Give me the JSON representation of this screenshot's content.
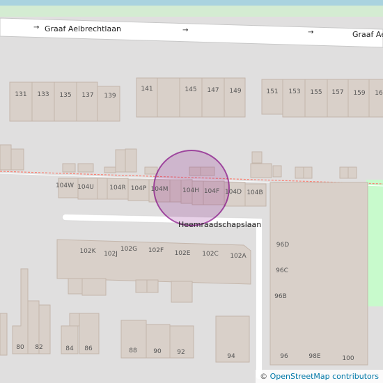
{
  "map": {
    "water_color": "#aad3df",
    "park_color": "#c8facc",
    "road_color": "#ffffff",
    "building_color": "#d9d0c9",
    "marker_color": "#800080",
    "streets": {
      "top": "Graaf Aelbrechtlaan",
      "top_repeat": "Graaf Aelbrechtlaan",
      "middle": "Heemraadschapslaan"
    },
    "house_numbers": {
      "n131": "131",
      "n133": "133",
      "n135": "135",
      "n137": "137",
      "n139": "139",
      "n141": "141",
      "n145": "145",
      "n147": "147",
      "n149": "149",
      "n151": "151",
      "n153": "153",
      "n155": "155",
      "n157": "157",
      "n159": "159",
      "n16": "16",
      "n104W": "104W",
      "n104U": "104U",
      "n104R": "104R",
      "n104P": "104P",
      "n104M": "104M",
      "n104H": "104H",
      "n104F": "104F",
      "n104D": "104D",
      "n104B": "104B",
      "n102K": "102K",
      "n102J": "102J",
      "n102G": "102G",
      "n102F": "102F",
      "n102E": "102E",
      "n102C": "102C",
      "n102A": "102A",
      "n96D": "96D",
      "n96C": "96C",
      "n96B": "96B",
      "n80": "80",
      "n82": "82",
      "n84": "84",
      "n86": "86",
      "n88": "88",
      "n90": "90",
      "n92": "92",
      "n94": "94",
      "n96": "96",
      "n98E": "98E",
      "n100": "100"
    },
    "attribution": {
      "symbol": "©",
      "text": "OpenStreetMap contributors"
    }
  }
}
